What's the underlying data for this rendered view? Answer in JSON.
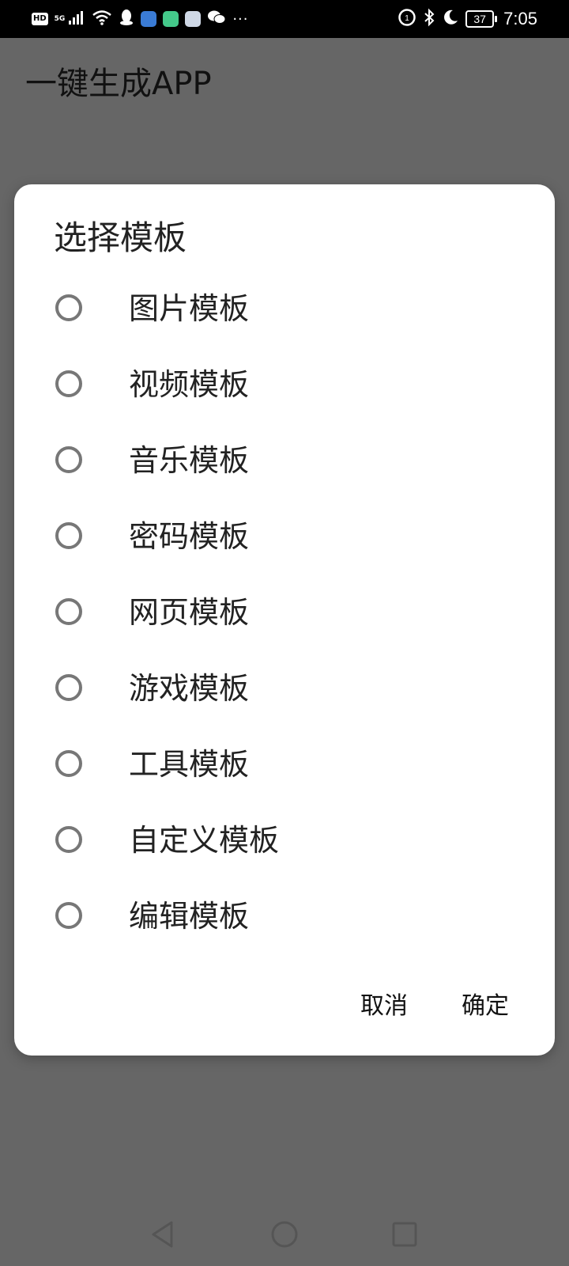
{
  "status_bar": {
    "hd_badge": "HD",
    "network": "5G",
    "time": "7:05",
    "battery": "37",
    "more": "···",
    "icons": [
      "hd-icon",
      "signal-icon",
      "wifi-icon",
      "qq-icon",
      "app-icon",
      "app-icon",
      "app-icon",
      "wechat-icon",
      "data-saver-icon",
      "bluetooth-icon",
      "moon-icon",
      "battery-icon"
    ]
  },
  "app_bar": {
    "title": "一键生成APP"
  },
  "dialog": {
    "title": "选择模板",
    "options": [
      {
        "label": "图片模板",
        "selected": false
      },
      {
        "label": "视频模板",
        "selected": false
      },
      {
        "label": "音乐模板",
        "selected": false
      },
      {
        "label": "密码模板",
        "selected": false
      },
      {
        "label": "网页模板",
        "selected": false
      },
      {
        "label": "游戏模板",
        "selected": false
      },
      {
        "label": "工具模板",
        "selected": false
      },
      {
        "label": "自定义模板",
        "selected": false
      },
      {
        "label": "编辑模板",
        "selected": false
      }
    ],
    "cancel_label": "取消",
    "ok_label": "确定"
  },
  "nav_bar": {
    "icons": [
      "back-icon",
      "home-icon",
      "recent-apps-icon"
    ]
  },
  "colors": {
    "scrim": "#666666",
    "status_bar": "#000000",
    "dialog_bg": "#ffffff",
    "radio_border": "#777777",
    "text": "#222222"
  }
}
